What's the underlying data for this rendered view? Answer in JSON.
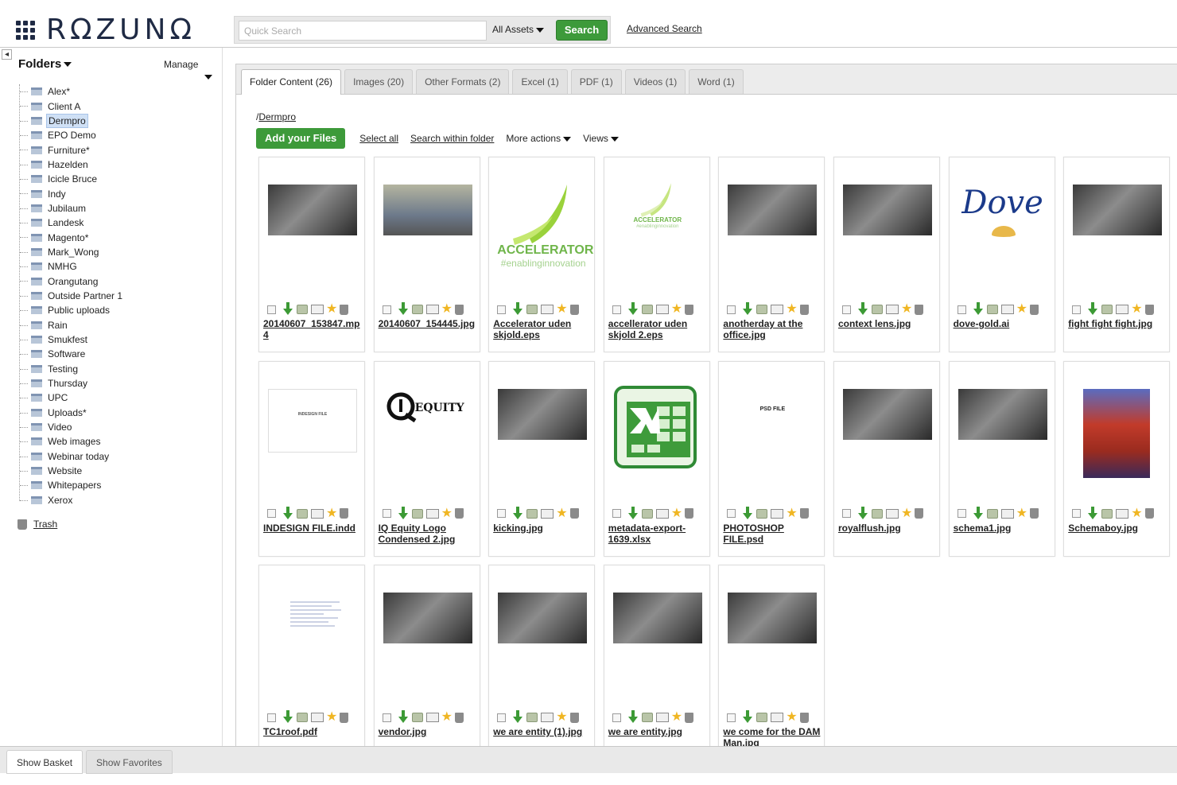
{
  "header": {
    "logo_text": "RΩZUNΩ",
    "search_placeholder": "Quick Search",
    "asset_filter": "All Assets",
    "search_button": "Search",
    "advanced_search": "Advanced Search"
  },
  "sidebar": {
    "title": "Folders",
    "manage": "Manage",
    "folders": [
      "Alex*",
      "Client A",
      "Dermpro",
      "EPO Demo",
      "Furniture*",
      "Hazelden",
      "Icicle Bruce",
      "Indy",
      "Jubilaum",
      "Landesk",
      "Magento*",
      "Mark_Wong",
      "NMHG",
      "Orangutang",
      "Outside Partner 1",
      "Public uploads",
      "Rain",
      "Smukfest",
      "Software",
      "Testing",
      "Thursday",
      "UPC",
      "Uploads*",
      "Video",
      "Web images",
      "Webinar today",
      "Website",
      "Whitepapers",
      "Xerox"
    ],
    "selected_folder": "Dermpro",
    "trash": "Trash"
  },
  "tabs": [
    "Folder Content (26)",
    "Images (20)",
    "Other Formats (2)",
    "Excel (1)",
    "PDF (1)",
    "Videos (1)",
    "Word (1)"
  ],
  "breadcrumb": {
    "separator": "/",
    "folder": "Dermpro"
  },
  "toolbar": {
    "add_files": "Add your Files",
    "select_all": "Select all",
    "search_within": "Search within folder",
    "more_actions": "More actions",
    "views": "Views"
  },
  "assets": [
    {
      "name": "20140607_153847.mp4",
      "thumb": "photo-dark"
    },
    {
      "name": "20140607_154445.jpg",
      "thumb": "office"
    },
    {
      "name": "Accelerator uden skjold.eps",
      "thumb": "accel"
    },
    {
      "name": "accellerator uden skjold 2.eps",
      "thumb": "accel-small"
    },
    {
      "name": "anotherday at the office.jpg",
      "thumb": "photo-dark"
    },
    {
      "name": "context lens.jpg",
      "thumb": "photo-dark"
    },
    {
      "name": "dove-gold.ai",
      "thumb": "dove"
    },
    {
      "name": "fight fight fight.jpg",
      "thumb": "photo-dark"
    },
    {
      "name": "INDESIGN FILE.indd",
      "thumb": "blank"
    },
    {
      "name": "IQ Equity Logo Condensed 2.jpg",
      "thumb": "iq"
    },
    {
      "name": "kicking.jpg",
      "thumb": "photo-dark"
    },
    {
      "name": "metadata-export-1639.xlsx",
      "thumb": "excel"
    },
    {
      "name": "PHOTOSHOP FILE.psd",
      "thumb": "psd"
    },
    {
      "name": "royalflush.jpg",
      "thumb": "photo-dark"
    },
    {
      "name": "schema1.jpg",
      "thumb": "photo-dark"
    },
    {
      "name": "Schemaboy.jpg",
      "thumb": "face"
    },
    {
      "name": "TC1roof.pdf",
      "thumb": "doc"
    },
    {
      "name": "vendor.jpg",
      "thumb": "photo-dark"
    },
    {
      "name": "we are entity (1).jpg",
      "thumb": "photo-dark"
    },
    {
      "name": "we are entity.jpg",
      "thumb": "photo-dark"
    },
    {
      "name": "we come for the DAM Man.jpg",
      "thumb": "photo-dark"
    }
  ],
  "thumb_text": {
    "accel_title": "ACCELERATOR",
    "accel_tag": "#enablinginnovation",
    "dove": "Dove",
    "iq": "EQUITY",
    "psd": "PSD FILE",
    "indesign": "INDESIGN FILE"
  },
  "footer": {
    "basket": "Show Basket",
    "favorites": "Show Favorites"
  },
  "colors": {
    "accent_green": "#3d9a3a",
    "brand_navy": "#1f2a44",
    "star": "#f0b623"
  }
}
